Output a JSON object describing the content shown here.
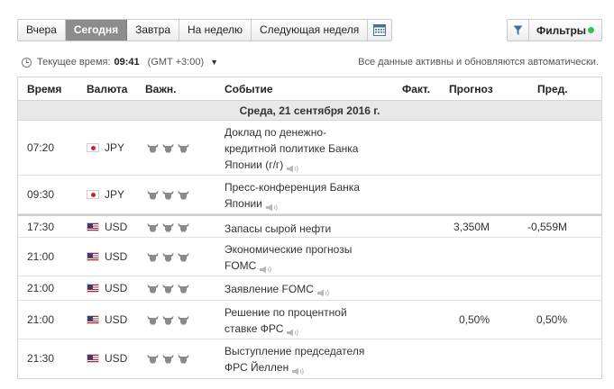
{
  "nav": {
    "tabs": [
      {
        "label": "Вчера"
      },
      {
        "label": "Сегодня"
      },
      {
        "label": "Завтра"
      },
      {
        "label": "На неделю"
      },
      {
        "label": "Следующая неделя"
      }
    ],
    "calendar_icon": "calendar-icon",
    "filter_label": "Фильтры",
    "filter_status_color": "#3dbd5a"
  },
  "time": {
    "label": "Текущее время:",
    "value": "09:41",
    "tz": "(GMT +3:00)",
    "auto_note": "Все данные активны и обновляются автоматически."
  },
  "table": {
    "headers": {
      "time": "Время",
      "currency": "Валюта",
      "importance": "Важн.",
      "event": "Событие",
      "actual": "Факт.",
      "forecast": "Прогноз",
      "previous": "Пред."
    },
    "date": "Среда, 21 сентября 2016 г.",
    "rows": [
      {
        "time": "07:20",
        "currency": "JPY",
        "flag": "jp",
        "event": "Доклад по денежно-кредитной политике Банка Японии (г/г)",
        "actual": "",
        "forecast": "",
        "previous": ""
      },
      {
        "time": "09:30",
        "currency": "JPY",
        "flag": "jp",
        "event": "Пресс-конференция Банка Японии",
        "actual": "",
        "forecast": "",
        "previous": ""
      },
      {
        "time": "17:30",
        "currency": "USD",
        "flag": "us",
        "event": "Запасы сырой нефти",
        "actual": "",
        "forecast": "3,350M",
        "previous": "-0,559M"
      },
      {
        "time": "21:00",
        "currency": "USD",
        "flag": "us",
        "event": "Экономические прогнозы FOMC",
        "actual": "",
        "forecast": "",
        "previous": ""
      },
      {
        "time": "21:00",
        "currency": "USD",
        "flag": "us",
        "event": "Заявление FOMC",
        "actual": "",
        "forecast": "",
        "previous": ""
      },
      {
        "time": "21:00",
        "currency": "USD",
        "flag": "us",
        "event": "Решение по процентной ставке ФРС",
        "actual": "",
        "forecast": "0,50%",
        "previous": "0,50%"
      },
      {
        "time": "21:30",
        "currency": "USD",
        "flag": "us",
        "event": "Выступление председателя ФРС Йеллен",
        "actual": "",
        "forecast": "",
        "previous": ""
      }
    ]
  }
}
